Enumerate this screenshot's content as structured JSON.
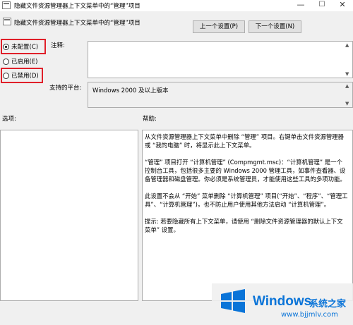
{
  "window": {
    "title": "隐藏文件资源管理器上下文菜单中的“管理”项目",
    "minimize": "—",
    "maximize": "☐",
    "close": "✕"
  },
  "header": {
    "title": "隐藏文件资源管理器上下文菜单中的“管理”项目",
    "prev_label": "上一个设置(P)",
    "next_label": "下一个设置(N)"
  },
  "radios": [
    {
      "label": "未配置(C)",
      "checked": true
    },
    {
      "label": "已启用(E)",
      "checked": false
    },
    {
      "label": "已禁用(D)",
      "checked": false
    }
  ],
  "labels": {
    "comment": "注释:",
    "platform": "支持的平台:",
    "options": "选项:",
    "help": "帮助:"
  },
  "platform_value": "Windows 2000 及以上版本",
  "help_paragraphs": [
    "从文件资源管理器上下文菜单中删除 “管理” 项目。右键单击文件资源管理器或 “我的电脑” 时，将显示此上下文菜单。",
    "“管理” 项目打开 “计算机管理” (Compmgmt.msc)：“计算机管理” 是一个控制台工具，包括很多主要的 Windows 2000 管理工具，如事件查看器、设备管理器和磁盘管理。你必须是系统管理员，才能使用这些工具的多项功能。",
    "此设置不会从 “开始” 菜单删除 “计算机管理” 项目(“开始”、“程序”、“管理工具”、“计算机管理”)，也不防止用户使用其他方法启动 “计算机管理”。",
    "提示: 若要隐藏所有上下文菜单，请使用 “删除文件资源管理器的默认上下文菜单” 设置。"
  ],
  "watermark": {
    "brand": "Windows",
    "brand_cn": "系统之家",
    "url": "www.bjjmlv.com"
  },
  "colors": {
    "highlight": "#e0202a",
    "accent": "#0a74d8"
  }
}
